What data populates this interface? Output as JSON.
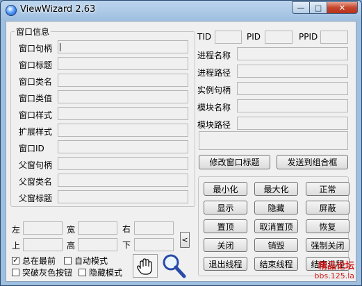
{
  "window": {
    "title": "ViewWizard 2.63"
  },
  "caption": {
    "min": "—",
    "max": "□",
    "close": "✕"
  },
  "window_info": {
    "group_title": "窗口信息",
    "fields": [
      {
        "label": "窗口句柄",
        "value": ""
      },
      {
        "label": "窗口标题",
        "value": ""
      },
      {
        "label": "窗口类名",
        "value": ""
      },
      {
        "label": "窗口类值",
        "value": ""
      },
      {
        "label": "窗口样式",
        "value": ""
      },
      {
        "label": "扩展样式",
        "value": ""
      },
      {
        "label": "窗口ID",
        "value": ""
      },
      {
        "label": "父窗句柄",
        "value": ""
      },
      {
        "label": "父窗类名",
        "value": ""
      },
      {
        "label": "父窗标题",
        "value": ""
      }
    ]
  },
  "process": {
    "tid_label": "TID",
    "pid_label": "PID",
    "ppid_label": "PPID",
    "tid": "",
    "pid": "",
    "ppid": "",
    "fields": [
      {
        "label": "进程名称",
        "value": ""
      },
      {
        "label": "进程路径",
        "value": ""
      },
      {
        "label": "实例句柄",
        "value": ""
      },
      {
        "label": "模块名称",
        "value": ""
      },
      {
        "label": "模块路径",
        "value": ""
      }
    ],
    "extra": ""
  },
  "rect": {
    "left_label": "左",
    "width_label": "宽",
    "right_label": "右",
    "top_label": "上",
    "height_label": "高",
    "bottom_label": "下",
    "collapse": "<"
  },
  "options": {
    "always_top": {
      "label": "总在最前",
      "checked": true
    },
    "auto_mode": {
      "label": "自动模式",
      "checked": false
    },
    "break_gray": {
      "label": "突破灰色按钮",
      "checked": false
    },
    "hide_mode": {
      "label": "隐藏模式",
      "checked": false
    }
  },
  "actions": {
    "modify_title": "修改窗口标题",
    "send_combo": "发送到组合框",
    "grid": [
      [
        "最小化",
        "最大化",
        "正常"
      ],
      [
        "显示",
        "隐藏",
        "屏蔽"
      ],
      [
        "置顶",
        "取消置顶",
        "恢复"
      ],
      [
        "关闭",
        "销毁",
        "强制关闭"
      ],
      [
        "退出线程",
        "结束线程",
        "结束进程"
      ]
    ]
  },
  "watermark": {
    "line1": "精品论坛",
    "line2": "bbs.125.la"
  }
}
